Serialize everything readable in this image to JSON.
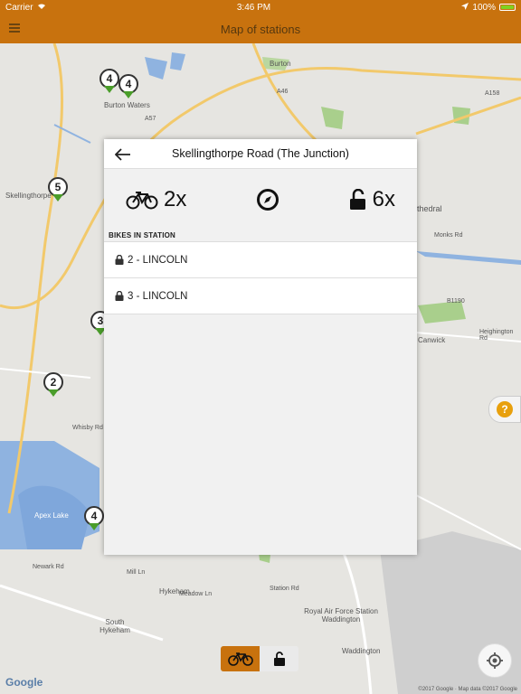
{
  "status_bar": {
    "carrier": "Carrier",
    "time": "3:46 PM",
    "battery": "100%"
  },
  "nav": {
    "title": "Map of stations"
  },
  "map": {
    "labels": [
      "Burton",
      "Burton Waters",
      "Skellingthorpe",
      "Hykeham",
      "South Hykeham",
      "Apex Lake",
      "Canwick",
      "Waddington",
      "Royal Air Force Station Waddington",
      "Heighington Rd",
      "Lincoln Rd",
      "Monks Rd",
      "Whisby Rd",
      "Newark Rd",
      "Station Rd",
      "Meadow Ln",
      "Mill Ln",
      "A46",
      "A57",
      "A158",
      "B1190",
      "thedral",
      "Birchwood"
    ],
    "pins": [
      {
        "count": "4"
      },
      {
        "count": "4"
      },
      {
        "count": "5"
      },
      {
        "count": "3"
      },
      {
        "count": "2"
      },
      {
        "count": "4"
      }
    ],
    "google": "Google",
    "credits": "©2017 Google · Map data ©2017 Google"
  },
  "modal": {
    "title": "Skellingthorpe Road (The Junction)",
    "bikes_count": "2x",
    "locks_count": "6x",
    "section_label": "BIKES IN STATION",
    "bikes": [
      {
        "label": "2 - LINCOLN"
      },
      {
        "label": "3 - LINCOLN"
      }
    ]
  },
  "colors": {
    "brand": "#c8720e",
    "pin_green": "#4a9d2a",
    "help": "#e8a00d"
  }
}
